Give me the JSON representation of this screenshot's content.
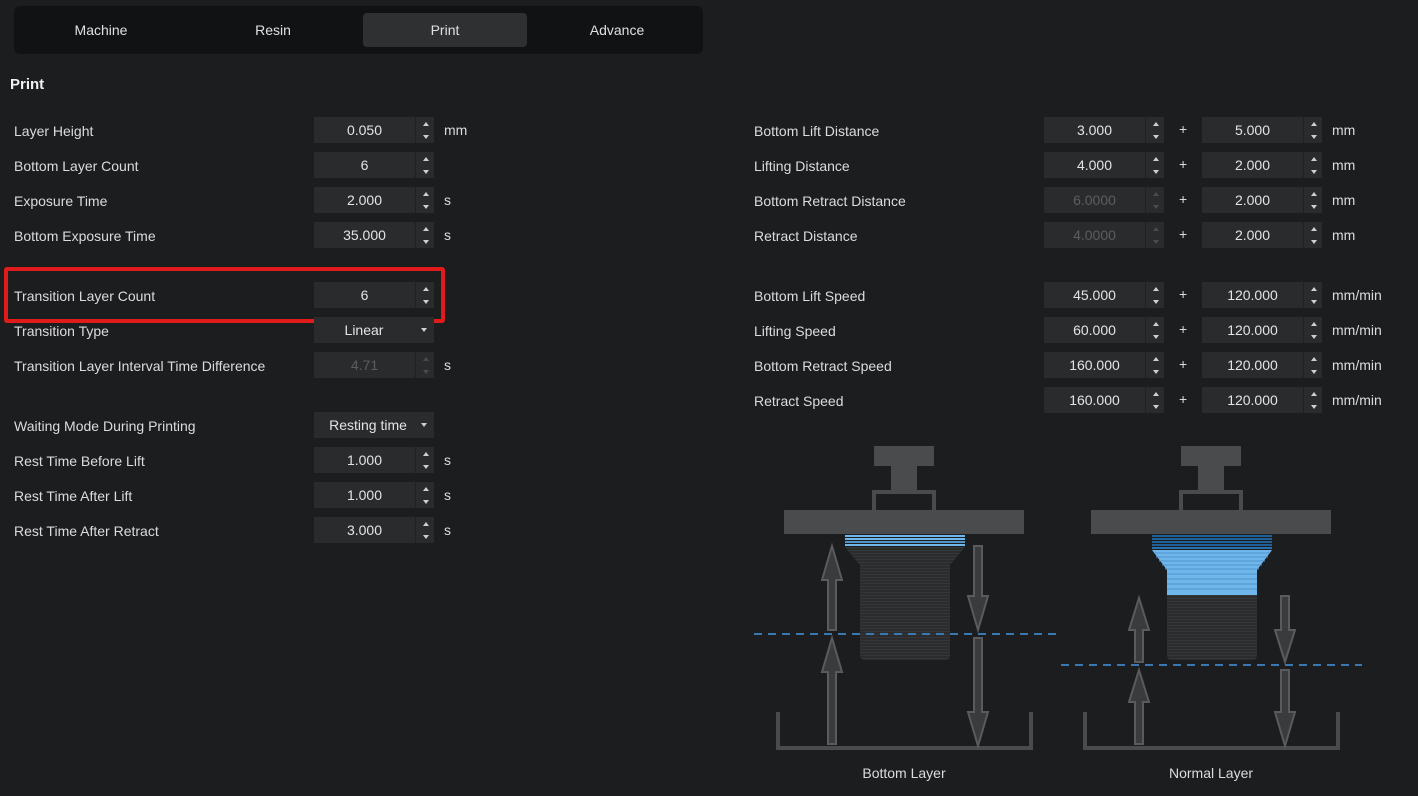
{
  "tabs": [
    {
      "label": "Machine"
    },
    {
      "label": "Resin"
    },
    {
      "label": "Print"
    },
    {
      "label": "Advance"
    }
  ],
  "active_tab": "Print",
  "section_title": "Print",
  "left": {
    "layer_height": {
      "label": "Layer Height",
      "value": "0.050",
      "unit": "mm"
    },
    "bottom_layer_count": {
      "label": "Bottom Layer Count",
      "value": "6"
    },
    "exposure_time": {
      "label": "Exposure Time",
      "value": "2.000",
      "unit": "s"
    },
    "bottom_exposure_time": {
      "label": "Bottom Exposure Time",
      "value": "35.000",
      "unit": "s"
    },
    "transition_layer_count": {
      "label": "Transition Layer Count",
      "value": "6"
    },
    "transition_type": {
      "label": "Transition Type",
      "value": "Linear"
    },
    "transition_interval": {
      "label": "Transition Layer Interval Time Difference",
      "value": "4.71",
      "unit": "s"
    },
    "waiting_mode": {
      "label": "Waiting Mode During Printing",
      "value": "Resting time"
    },
    "rest_before_lift": {
      "label": "Rest Time Before Lift",
      "value": "1.000",
      "unit": "s"
    },
    "rest_after_lift": {
      "label": "Rest Time After Lift",
      "value": "1.000",
      "unit": "s"
    },
    "rest_after_retract": {
      "label": "Rest Time After Retract",
      "value": "3.000",
      "unit": "s"
    }
  },
  "right": {
    "plus": "+",
    "bottom_lift_distance": {
      "label": "Bottom Lift Distance",
      "value1": "3.000",
      "value2": "5.000",
      "unit": "mm"
    },
    "lifting_distance": {
      "label": "Lifting Distance",
      "value1": "4.000",
      "value2": "2.000",
      "unit": "mm"
    },
    "bottom_retract_distance": {
      "label": "Bottom Retract Distance",
      "value1": "6.0000",
      "value2": "2.000",
      "unit": "mm"
    },
    "retract_distance": {
      "label": "Retract Distance",
      "value1": "4.0000",
      "value2": "2.000",
      "unit": "mm"
    },
    "bottom_lift_speed": {
      "label": "Bottom Lift Speed",
      "value1": "45.000",
      "value2": "120.000",
      "unit": "mm/min"
    },
    "lifting_speed": {
      "label": "Lifting Speed",
      "value1": "60.000",
      "value2": "120.000",
      "unit": "mm/min"
    },
    "bottom_retract_speed": {
      "label": "Bottom Retract Speed",
      "value1": "160.000",
      "value2": "120.000",
      "unit": "mm/min"
    },
    "retract_speed": {
      "label": "Retract Speed",
      "value1": "160.000",
      "value2": "120.000",
      "unit": "mm/min"
    }
  },
  "diagrams": {
    "bottom_caption": "Bottom Layer",
    "normal_caption": "Normal Layer",
    "colors": {
      "layer_light": "#6fb6ea",
      "layer_dark": "#1f5f9a",
      "dash": "#3a78b0",
      "machine": "#4a4b4d"
    }
  }
}
